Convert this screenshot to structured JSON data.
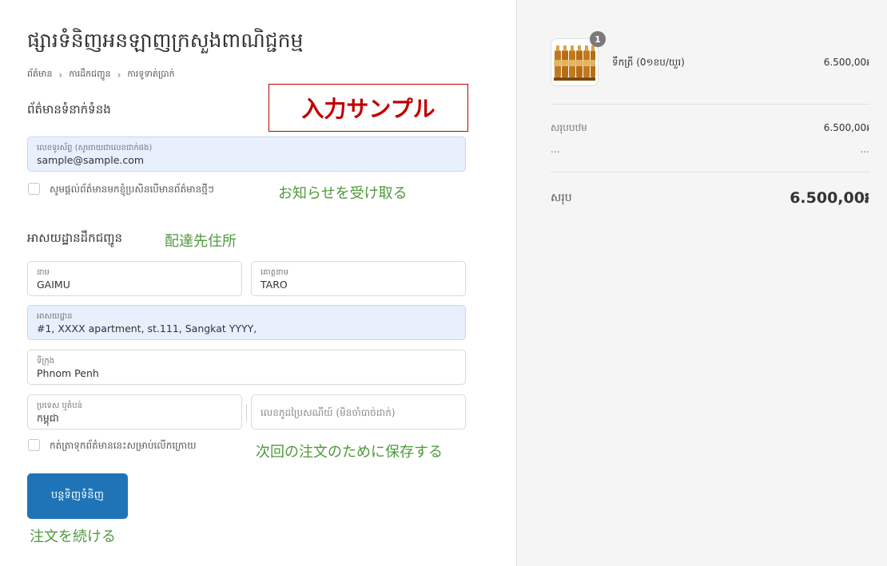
{
  "store_title": "ផ្សារទំនិញអនឡាញក្រសួងពាណិជ្ជកម្ម",
  "breadcrumb": {
    "items": [
      "ព័ត៌មាន",
      "ការដឹកជញ្ជូន",
      "ការទូទាត់ប្រាក់"
    ],
    "separator": "›"
  },
  "contact": {
    "heading": "ព័ត៌មានទំនាក់ទំនង",
    "sample_label": "入力サンプル",
    "email_label": "លេខទូរស័ព្ទ (សូមរាយជាលេខជាក់ផង)",
    "email_value": "sample@sample.com",
    "newsletter_label": "សូមផ្ដល់ព័ត៌មានមកខ្ញុំប្រសិនបើមានព័ត៌មានថ្មីៗ",
    "newsletter_annotation": "お知らせを受け取る"
  },
  "shipping": {
    "heading": "អាសយដ្ឋានដឹកជញ្ជូន",
    "heading_annotation": "配達先住所",
    "first_name_label": "នាម",
    "first_name_value": "GAIMU",
    "last_name_label": "គោត្តនាម",
    "last_name_value": "TARO",
    "address_label": "អាសយដ្ឋាន",
    "address_value": "#1, XXXX apartment, st.111, Sangkat YYYY,",
    "city_label": "ទីក្រុង",
    "city_value": "Phnom Penh",
    "country_label": "ប្រទេស ឬតំបន់",
    "country_value": "កម្ពុជា",
    "postal_placeholder": "លេខកូដប្រៃសណីយ៍ (មិនចាំបាច់ដាក់)",
    "save_label": "កត់ត្រាទុកព័ត៌មាននេះសម្រាប់លើកក្រោយ",
    "save_annotation": "次回の注文のために保存する"
  },
  "continue_button": {
    "label": "បន្តទិញទំនិញ",
    "annotation": "注文を続ける"
  },
  "summary": {
    "item": {
      "quantity_badge": "1",
      "name": "ទឹកត្រី (0១ខប/យួរ)",
      "price": "6.500,00៛"
    },
    "subtotal_label": "សរុបបឋម",
    "subtotal_value": "6.500,00៛",
    "shipping_label": "...",
    "shipping_value": "...",
    "total_label": "សរុប",
    "total_value": "6.500,00៛"
  },
  "colors": {
    "primary_button": "#1f74b7",
    "annotation_green": "#4e9a3a",
    "sample_red": "#c00000",
    "filled_field": "#e8f0fe"
  }
}
